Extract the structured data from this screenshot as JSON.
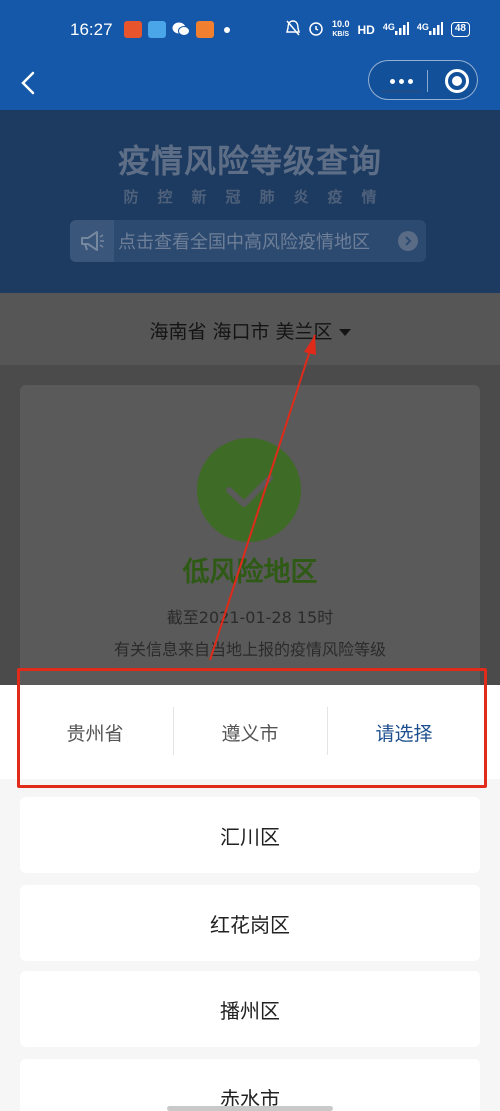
{
  "status_bar": {
    "time": "16:27",
    "network_speed_value": "10.0",
    "network_speed_unit": "KB/S",
    "hd_label": "HD",
    "signal_1": "4G",
    "signal_2": "4G",
    "battery": "48",
    "app_icons": [
      "app-icon-red",
      "app-icon-blue",
      "wechat-icon",
      "app-icon-orange"
    ],
    "status_icons": [
      "mute-icon",
      "alarm-icon"
    ]
  },
  "nav": {
    "back_icon": "chevron-left-icon",
    "more_icon": "more-dots-icon",
    "close_icon": "target-close-icon"
  },
  "banner": {
    "title": "疫情风险等级查询",
    "subtitle": "防控新冠肺炎疫情",
    "notice_text": "点击查看全国中高风险疫情地区",
    "notice_icon": "megaphone-icon",
    "arrow_icon": "chevron-right-icon"
  },
  "region": {
    "current": "海南省 海口市 美兰区"
  },
  "result": {
    "check_icon": "checkmark-icon",
    "risk_level": "低风险地区",
    "as_of": "截至2021-01-28 15时",
    "source": "有关信息来自当地上报的疫情风险等级"
  },
  "picker": {
    "tabs": [
      {
        "label": "贵州省"
      },
      {
        "label": "遵义市"
      },
      {
        "label": "请选择"
      }
    ],
    "active_tab_index": 2,
    "options": [
      {
        "label": "汇川区"
      },
      {
        "label": "红花岗区"
      },
      {
        "label": "播州区"
      },
      {
        "label": "赤水市"
      }
    ]
  },
  "colors": {
    "primary_blue": "#1557a8",
    "active_tab": "#1d4f8f",
    "low_risk_green": "#3e6b25",
    "annotation_red": "#e02a1a"
  }
}
